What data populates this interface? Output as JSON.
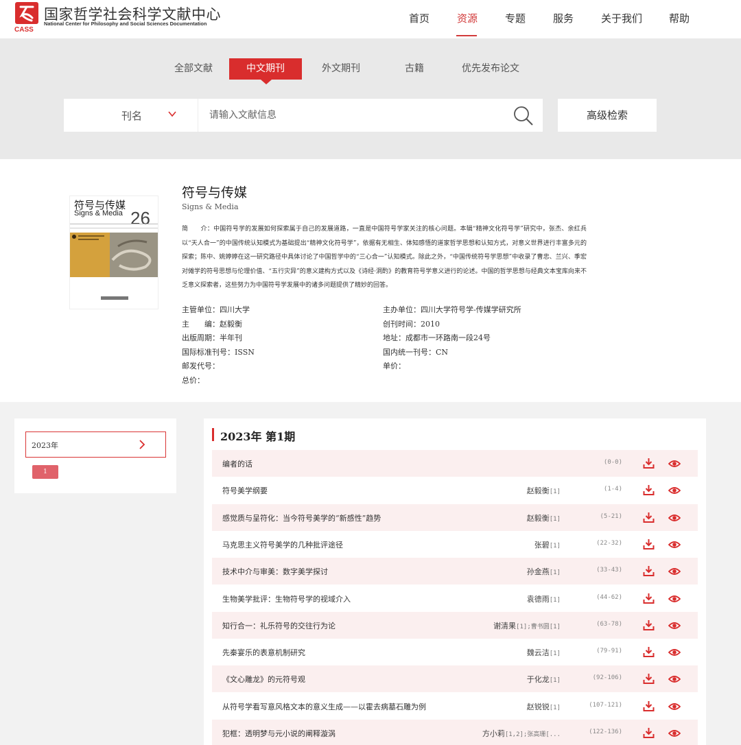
{
  "header": {
    "logo_text": "CASS",
    "site_title": "国家哲学社会科学文献中心",
    "site_subtitle": "National Center for Philosophy and Social Sciences Documentation",
    "nav": [
      {
        "label": "首页",
        "active": false
      },
      {
        "label": "资源",
        "active": true
      },
      {
        "label": "专题",
        "active": false
      },
      {
        "label": "服务",
        "active": false
      },
      {
        "label": "关于我们",
        "active": false
      },
      {
        "label": "帮助",
        "active": false
      }
    ]
  },
  "search": {
    "tabs": [
      {
        "label": "全部文献",
        "active": false
      },
      {
        "label": "中文期刊",
        "active": true
      },
      {
        "label": "外文期刊",
        "active": false
      },
      {
        "label": "古籍",
        "active": false
      },
      {
        "label": "优先发布论文",
        "active": false
      }
    ],
    "field_select": "刊名",
    "placeholder": "请输入文献信息",
    "advanced_label": "高级检索"
  },
  "journal": {
    "cover_title": "符号与传媒",
    "cover_en": "Signs & Media",
    "cover_issue": "26",
    "title": "符号与传媒",
    "en_title": "Signs & Media",
    "intro_label": "简　　介：",
    "intro": "中国符号学的发展如何探索属于自己的发展道路，一直是中国符号学家关注的核心问题。本辑“精神文化符号学”研究中，张杰、余红兵以“天人合一”的中国传统认知模式为基础提出“精神文化符号学”，依据有无相生、体知感悟的道家哲学思想和认知方式，对意义世界进行丰富多元的探索；陈中、姚婷婷在这一研究路径中具体讨论了中国哲学中的“三心合一”认知模式。除此之外，“中国传统符号学思想”中收录了曹忠、兰兴、季宏对傩学的符号思想与伦理价值、“五行灾异”的意义建构方式以及《诗经·洞酌》的教育符号学意义进行的论述。中国的哲学思想与经典文本宝库向来不乏意义探索者，这些努力为中国符号学发展中的诸多问题提供了精妙的回答。",
    "meta_left": [
      {
        "label": "主管单位：",
        "value": "四川大学"
      },
      {
        "label": "主　　编：",
        "value": "赵毅衡"
      },
      {
        "label": "出版周期：",
        "value": "半年刊"
      },
      {
        "label": "国际标准刊号：",
        "value": "ISSN"
      },
      {
        "label": "邮发代号：",
        "value": ""
      },
      {
        "label": "总价：",
        "value": ""
      }
    ],
    "meta_right": [
      {
        "label": "主办单位：",
        "value": "四川大学符号学-传媒学研究所"
      },
      {
        "label": "创刊时间：",
        "value": "2010"
      },
      {
        "label": "地址：",
        "value": "成都市一环路南一段24号"
      },
      {
        "label": "国内统一刊号：",
        "value": "CN"
      },
      {
        "label": "单价：",
        "value": ""
      }
    ]
  },
  "years": {
    "selected": "2023年",
    "page": "1"
  },
  "issue": {
    "title": "2023年 第1期",
    "articles": [
      {
        "title": "编者的话",
        "author": "",
        "ref": "",
        "pages": "(0-0)"
      },
      {
        "title": "符号美学纲要",
        "author": "赵毅衡",
        "ref": "[1]",
        "pages": "(1-4)"
      },
      {
        "title": "感觉质与呈符化：当今符号美学的“新感性”趋势",
        "author": "赵毅衡",
        "ref": "[1]",
        "pages": "(5-21)"
      },
      {
        "title": "马克思主义符号美学的几种批评途径",
        "author": "张碧",
        "ref": "[1]",
        "pages": "(22-32)"
      },
      {
        "title": "技术中介与审美：数字美学探讨",
        "author": "孙金燕",
        "ref": "[1]",
        "pages": "(33-43)"
      },
      {
        "title": "生物美学批评：生物符号学的视域介入",
        "author": "袁德雨",
        "ref": "[1]",
        "pages": "(44-62)"
      },
      {
        "title": "知行合一：礼乐符号的交往行为论",
        "author": "谢清果",
        "ref": "[1];曹书圆[1]",
        "pages": "(63-78)"
      },
      {
        "title": "先秦宴乐的表意机制研究",
        "author": "魏云洁",
        "ref": "[1]",
        "pages": "(79-91)"
      },
      {
        "title": "《文心雕龙》的元符号观",
        "author": "于化龙",
        "ref": "[1]",
        "pages": "(92-106)"
      },
      {
        "title": "从符号学看写意风格文本的意义生成——以霍去病墓石雕为例",
        "author": "赵锐锐",
        "ref": "[1]",
        "pages": "(107-121)"
      },
      {
        "title": "犯框：透明梦与元小说的阐释漩涡",
        "author": "方小莉",
        "ref": "[1,2];张高珊[...",
        "pages": "(122-136)"
      }
    ]
  },
  "colors": {
    "accent": "#d92d2d",
    "row_shade": "#fbefef",
    "page_bg": "#f2f2f2"
  }
}
